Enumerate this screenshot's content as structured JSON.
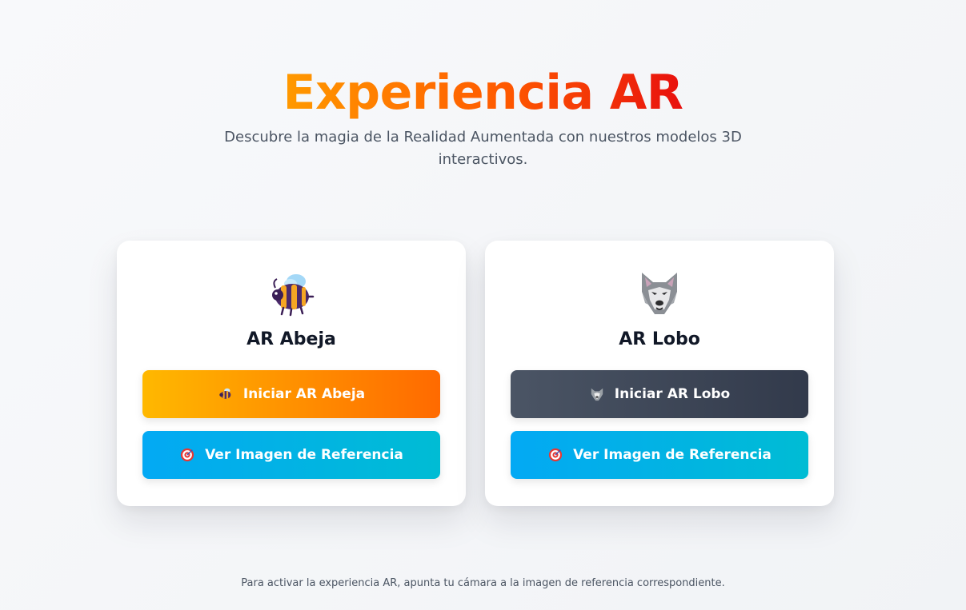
{
  "hero": {
    "title": "Experiencia AR",
    "subtitle": "Descubre la magia de la Realidad Aumentada con nuestros modelos 3D interactivos."
  },
  "cards": [
    {
      "icon": "bee-icon",
      "title": "AR Abeja",
      "start_label": "Iniciar AR Abeja",
      "start_icon": "bee-icon",
      "ref_label": "Ver Imagen de Referencia",
      "ref_icon": "target-icon"
    },
    {
      "icon": "wolf-icon",
      "title": "AR Lobo",
      "start_label": "Iniciar AR Lobo",
      "start_icon": "wolf-icon",
      "ref_label": "Ver Imagen de Referencia",
      "ref_icon": "target-icon"
    }
  ],
  "footer": {
    "text": "Para activar la experiencia AR, apunta tu cámara a la imagen de referencia correspondiente."
  },
  "colors": {
    "title_gradient": [
      "#ff9a00",
      "#ff5a00",
      "#e8100e"
    ],
    "bee_button": [
      "#ffb800",
      "#ff6a00"
    ],
    "wolf_button": [
      "#4b5565",
      "#323a4b"
    ],
    "reference_button": [
      "#03a9f4",
      "#00bcd4"
    ]
  }
}
